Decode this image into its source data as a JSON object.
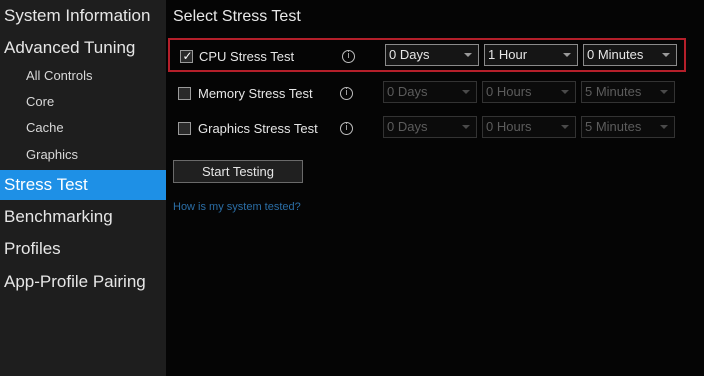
{
  "sidebar": {
    "items": [
      {
        "label": "System Information"
      },
      {
        "label": "Advanced Tuning"
      },
      {
        "label": "All Controls"
      },
      {
        "label": "Core"
      },
      {
        "label": "Cache"
      },
      {
        "label": "Graphics"
      },
      {
        "label": "Stress Test"
      },
      {
        "label": "Benchmarking"
      },
      {
        "label": "Profiles"
      },
      {
        "label": "App-Profile Pairing"
      }
    ],
    "active_color": "#1e90e6"
  },
  "main": {
    "title": "Select Stress Test",
    "tests": [
      {
        "label": "CPU Stress Test",
        "checked": true,
        "check_glyph": "✓",
        "days": "0 Days",
        "hours": "1 Hour",
        "minutes": "0 Minutes"
      },
      {
        "label": "Memory Stress Test",
        "checked": false,
        "days": "0 Days",
        "hours": "0 Hours",
        "minutes": "5 Minutes"
      },
      {
        "label": "Graphics Stress Test",
        "checked": false,
        "days": "0 Days",
        "hours": "0 Hours",
        "minutes": "5 Minutes"
      }
    ],
    "info_glyph": "i",
    "start_button": "Start Testing",
    "help_link": "How is my system tested?",
    "highlight_color": "#b51f2a"
  }
}
